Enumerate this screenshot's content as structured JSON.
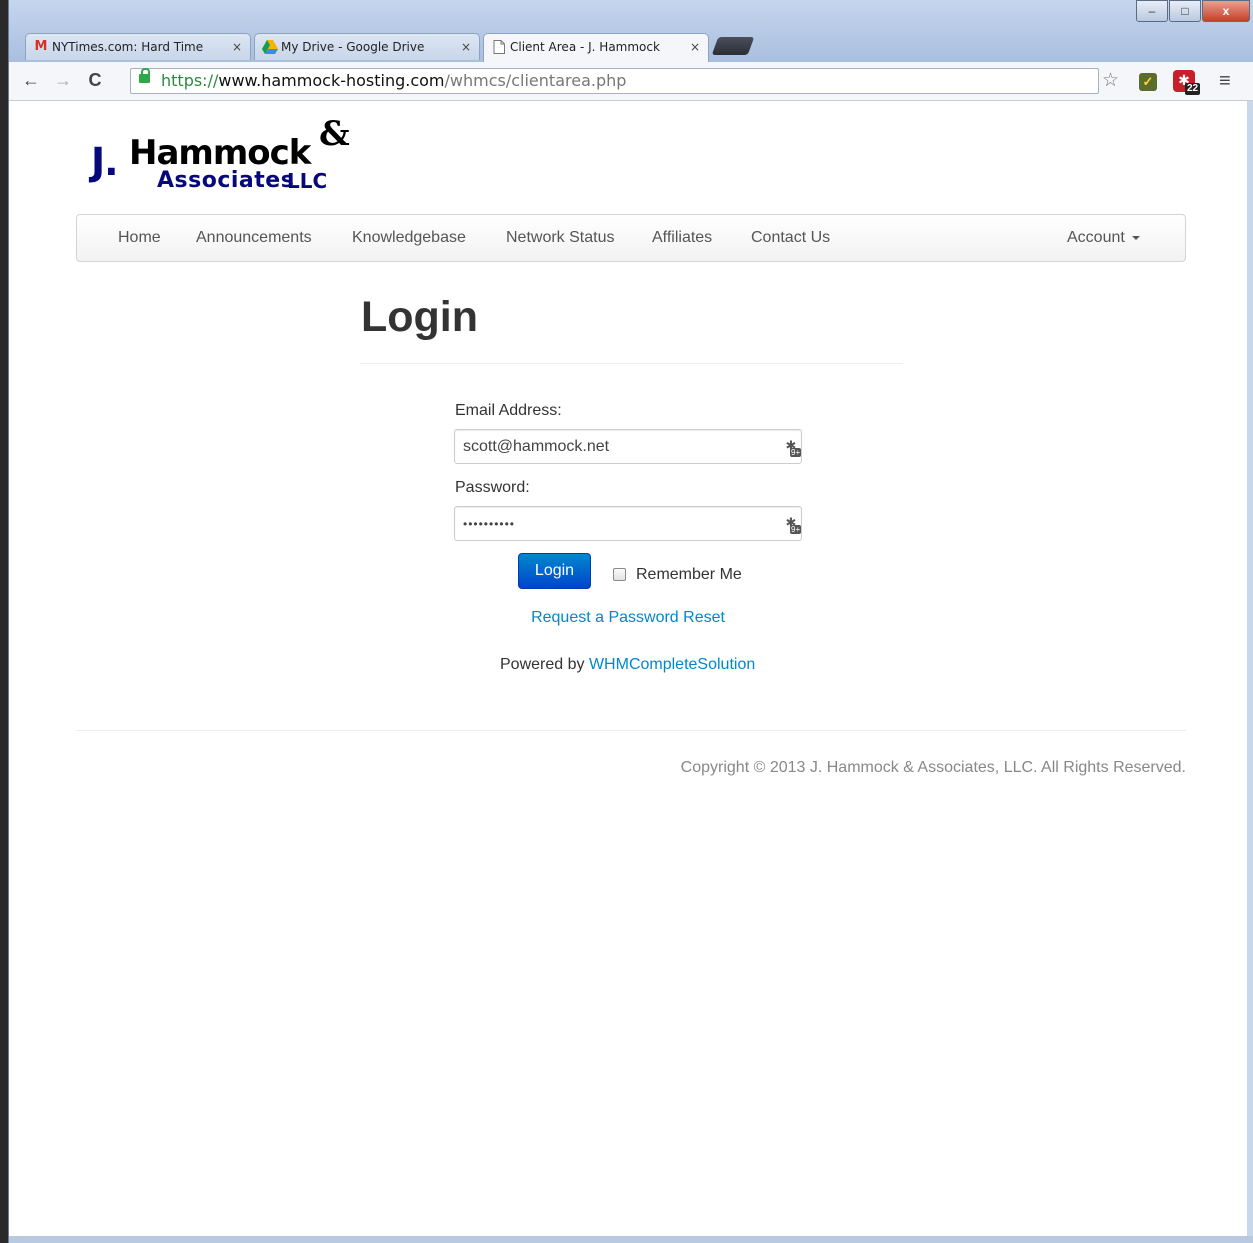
{
  "browser": {
    "tabs": [
      {
        "title": "NYTimes.com: Hard Time",
        "icon": "gmail-icon",
        "close": "×"
      },
      {
        "title": "My Drive - Google Drive",
        "icon": "google-drive-icon",
        "close": "×"
      },
      {
        "title": "Client Area - J. Hammock",
        "icon": "page-icon",
        "close": "×",
        "active": true
      }
    ],
    "window_controls": {
      "minimize": "–",
      "maximize": "□",
      "close": "x"
    },
    "url": {
      "scheme": "https://",
      "host": "www.hammock-hosting.com",
      "path": "/whmcs/clientarea.php"
    },
    "extension_badge": "22",
    "nav": {
      "back": "←",
      "forward": "→",
      "reload": "C",
      "star": "☆",
      "menu": "≡"
    }
  },
  "site": {
    "logo": {
      "j": "J.",
      "name": "Hammock",
      "amp": "&",
      "assoc": "Associates",
      "llc": "LLC"
    },
    "nav_items": [
      "Home",
      "Announcements",
      "Knowledgebase",
      "Network Status",
      "Affiliates",
      "Contact Us"
    ],
    "account_menu": "Account"
  },
  "login": {
    "title": "Login",
    "email_label": "Email Address:",
    "email_value": "scott@hammock.net",
    "password_label": "Password:",
    "password_value": "••••••••••",
    "password_manager_badge": "9+",
    "submit_label": "Login",
    "remember_label": "Remember Me",
    "reset_link": "Request a Password Reset",
    "powered_prefix": "Powered by",
    "powered_link": "WHMCompleteSolution"
  },
  "footer": {
    "copyright": "Copyright © 2013 J. Hammock & Associates, LLC. All Rights Reserved."
  },
  "colors": {
    "link": "#0088cc",
    "button_top": "#0088cc",
    "button_bottom": "#0044cc",
    "logo_blue": "#07087a"
  }
}
